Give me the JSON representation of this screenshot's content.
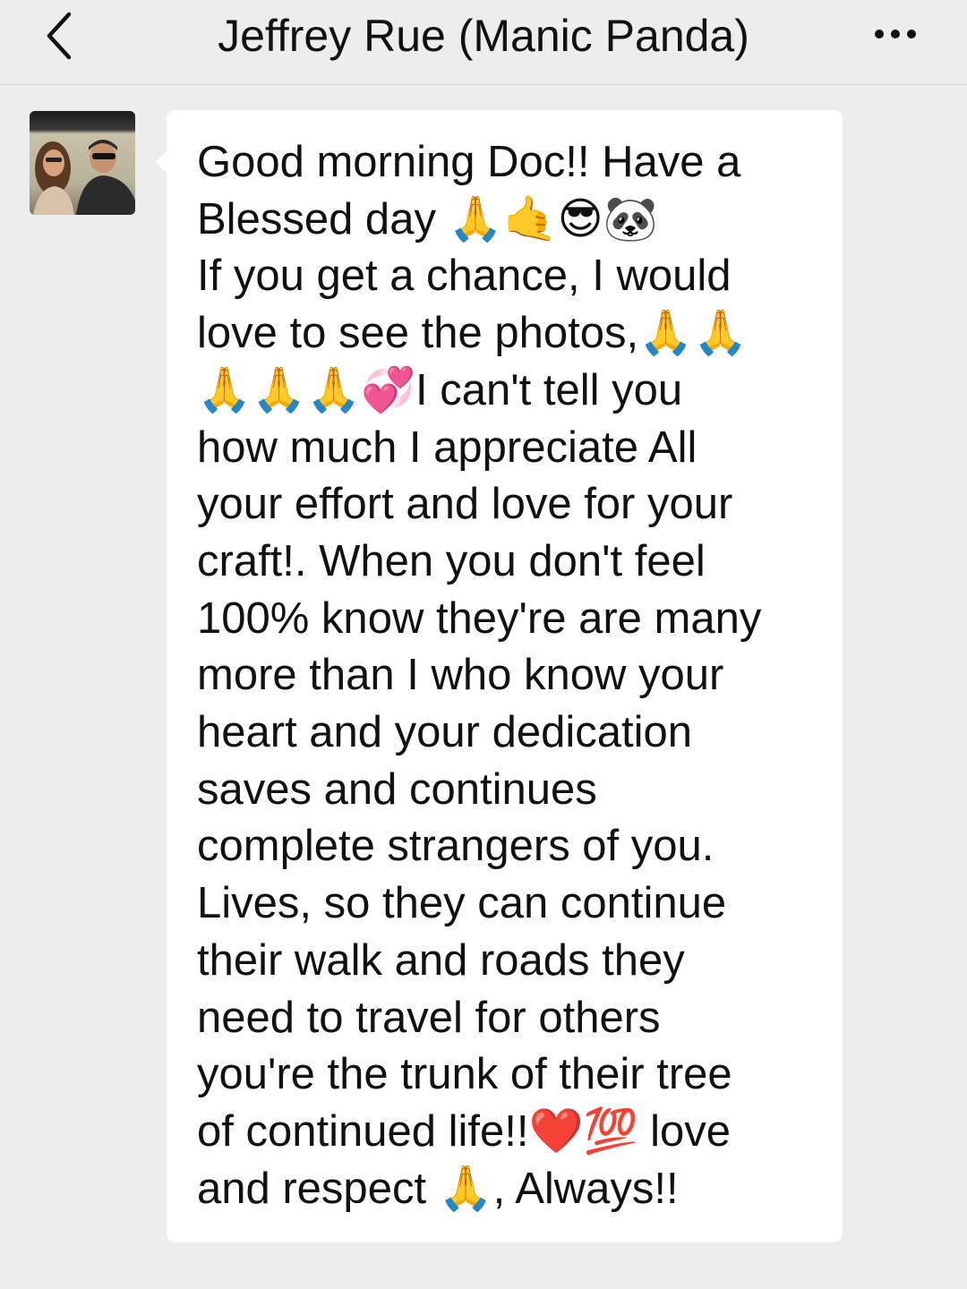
{
  "header": {
    "title": "Jeffrey Rue (Manic Panda)",
    "back_icon": "chevron-left-icon",
    "more_icon": "more-dots-icon"
  },
  "chat": {
    "messages": [
      {
        "sender": "Jeffrey Rue (Manic Panda)",
        "direction": "incoming",
        "text": "Good morning Doc!! Have a\nBlessed day 🙏🤙😎🐼\nIf you get a chance, I would\nlove to see the photos,🙏🙏\n🙏🙏🙏💞I can't tell you\nhow much I appreciate All\nyour effort and love for your\ncraft!. When you don't feel\n100% know they're are many\nmore than I who know your\nheart and your dedication\nsaves and continues\ncomplete strangers of you.\nLives, so they can continue\ntheir walk and roads they\nneed to travel for others\nyou're the trunk of their tree\nof continued life!!❤️💯 love\nand respect 🙏, Always!!"
      }
    ]
  },
  "colors": {
    "background": "#ededed",
    "bubble": "#ffffff",
    "text": "#111111"
  }
}
